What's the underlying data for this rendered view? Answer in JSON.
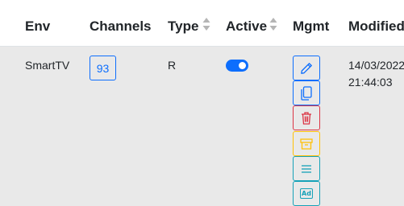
{
  "table": {
    "headers": {
      "env": "Env",
      "channels": "Channels",
      "type": "Type",
      "active": "Active",
      "mgmt": "Mgmt",
      "modified": "Modified"
    },
    "rows": [
      {
        "env": "SmartTV",
        "channels": "93",
        "type": "R",
        "active": true,
        "modified_date": "14/03/2022",
        "modified_time": "21:44:03"
      }
    ]
  },
  "colors": {
    "primary": "#0d6efd",
    "danger": "#dc3545",
    "warning": "#ffc107",
    "info": "#17a2b8",
    "row_background": "#e9e9e9",
    "header_background": "#ffffff"
  },
  "mgmt_actions": [
    {
      "icon": "pencil-icon",
      "color": "#0d6efd"
    },
    {
      "icon": "copy-icon",
      "color": "#0d6efd"
    },
    {
      "icon": "trash-icon",
      "color": "#dc3545"
    },
    {
      "icon": "archive-icon",
      "color": "#ffc107"
    },
    {
      "icon": "list-icon",
      "color": "#17a2b8"
    },
    {
      "icon": "ad-icon",
      "color": "#17a2b8",
      "label": "Ad"
    }
  ]
}
